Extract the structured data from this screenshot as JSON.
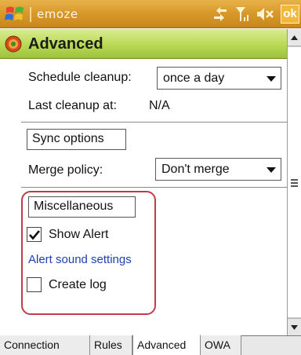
{
  "titlebar": {
    "app_title": "emoze",
    "ok_label": "ok",
    "icons": [
      "windows-start-logo",
      "connectivity-icon",
      "signal-icon",
      "speaker-mute-icon"
    ]
  },
  "header": {
    "title": "Advanced",
    "icon": "settings-circle-icon"
  },
  "schedule": {
    "label": "Schedule cleanup:",
    "value": "once a day"
  },
  "last_cleanup": {
    "label": "Last cleanup at:",
    "value": "N/A"
  },
  "sync": {
    "section_label": "Sync options",
    "merge_label": "Merge policy:",
    "merge_value": "Don't merge"
  },
  "misc": {
    "section_label": "Miscellaneous",
    "show_alert_label": "Show Alert",
    "show_alert_checked": true,
    "alert_sound_link": "Alert sound settings",
    "create_log_label": "Create log",
    "create_log_checked": false
  },
  "tabs": [
    {
      "label": "Connection",
      "active": false
    },
    {
      "label": "Rules",
      "active": false
    },
    {
      "label": "Advanced",
      "active": true
    },
    {
      "label": "OWA",
      "active": false
    }
  ],
  "colors": {
    "titlebar": "#d99a2c",
    "header": "#b9d955",
    "highlight_frame": "#c23a4a",
    "link": "#1f3fb0"
  }
}
